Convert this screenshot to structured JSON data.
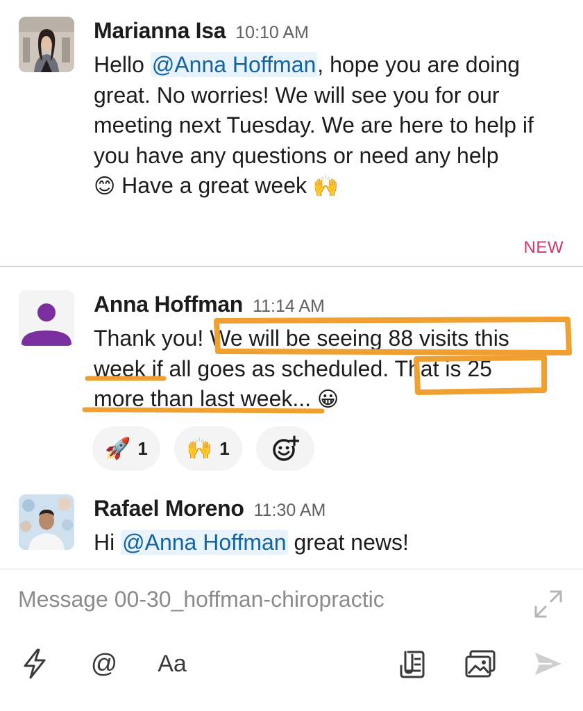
{
  "messages": [
    {
      "author": "Marianna Isa",
      "time": "10:10 AM",
      "text_a": "Hello ",
      "mention": "@Anna Hoffman",
      "text_b": ", hope you are doing great.  No worries! We will see you for our meeting next Tuesday. We are here to help if you have any questions or need any help",
      "emoji_a": "😊",
      "text_c": " Have a great week ",
      "emoji_b": "🙌"
    },
    {
      "author": "Anna Hoffman",
      "time": "11:14 AM",
      "line1": "Thank you!  We will be seeing 88 visits this",
      "line2": "week if all goes as scheduled.  That is 25",
      "line3": "more than last week...",
      "emoji": "😀",
      "reactions": [
        {
          "emoji": "🚀",
          "count": "1"
        },
        {
          "emoji": "🙌",
          "count": "1"
        }
      ]
    },
    {
      "author": "Rafael Moreno",
      "time": "11:30 AM",
      "text_a": "Hi ",
      "mention": "@Anna Hoffman",
      "text_b": " great news!"
    }
  ],
  "new_label": "NEW",
  "composer": {
    "placeholder": "Message 00-30_hoffman-chiropractic",
    "format_label": "Aa",
    "at_label": "@"
  },
  "colors": {
    "mention": "#1264a3",
    "new": "#d1366b",
    "annotation": "#f0a030",
    "avatar_anna": "#7b2e9e"
  },
  "icons": [
    "lightning-icon",
    "at-icon",
    "text-format-icon",
    "attach-file-icon",
    "photo-icon",
    "send-icon",
    "expand-icon",
    "add-reaction-icon"
  ]
}
